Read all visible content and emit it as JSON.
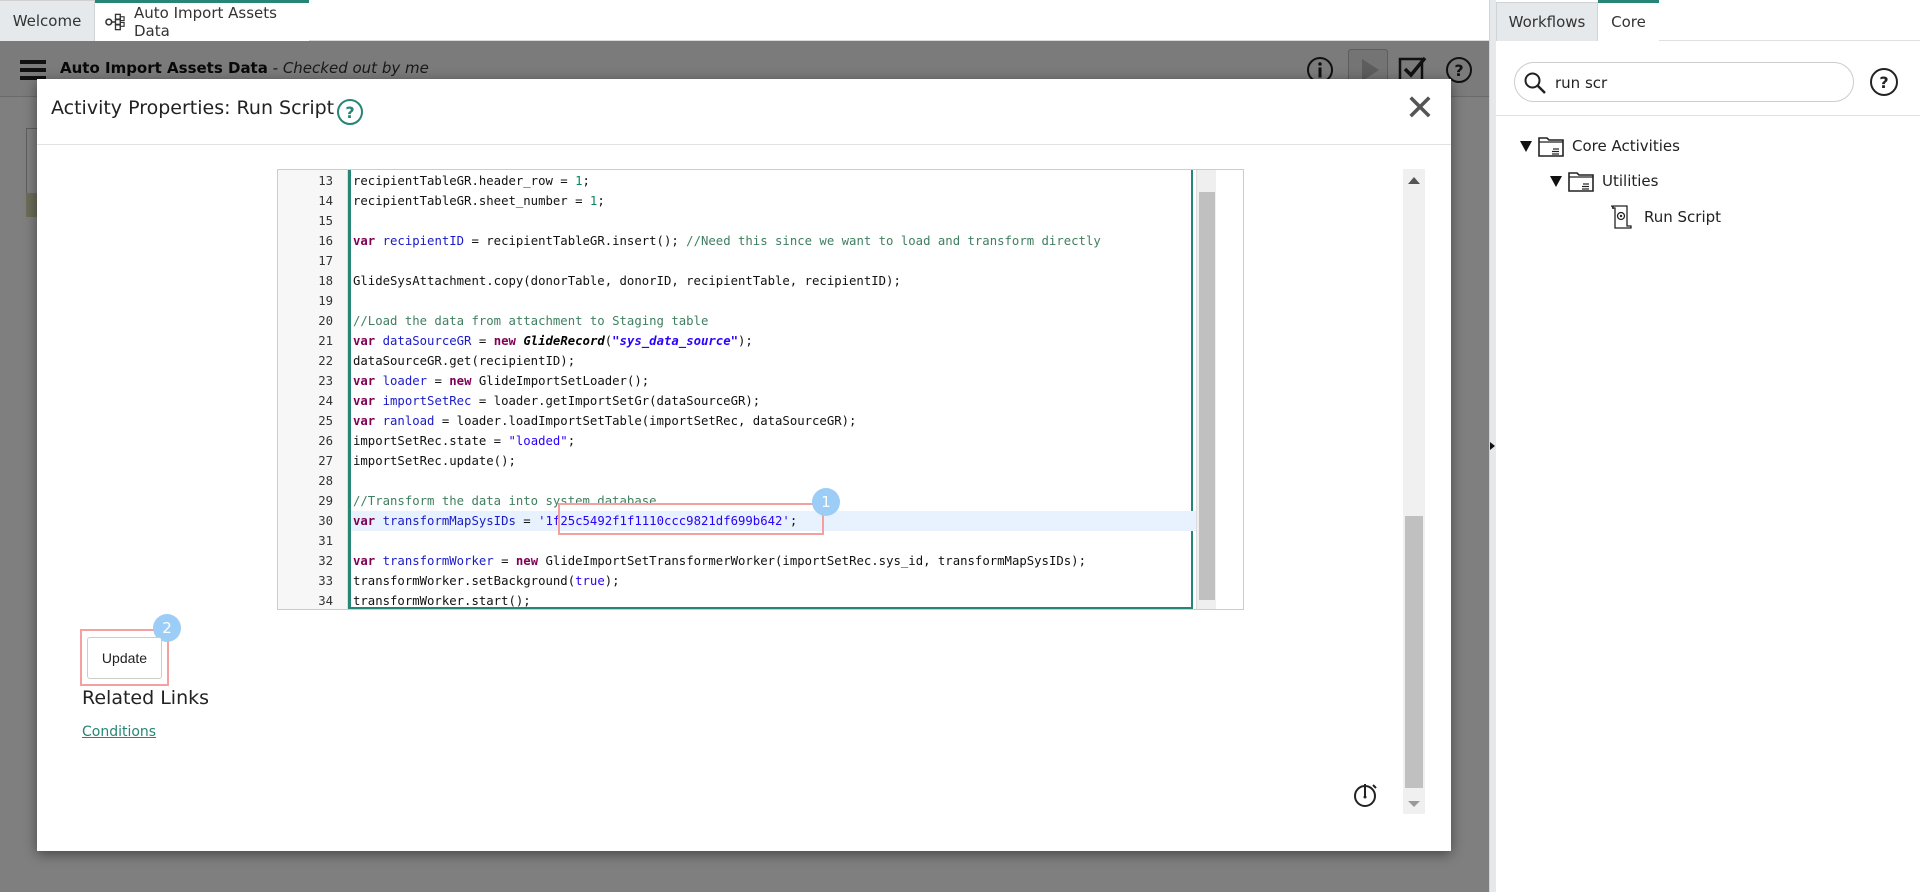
{
  "tabs": {
    "welcome": "Welcome",
    "workflow": "Auto Import Assets Data",
    "workflow_icon": "workflow-icon"
  },
  "header": {
    "workflow_name": "Auto Import Assets Data",
    "status": "- Checked out by me",
    "icons": [
      "menu-icon",
      "info-icon",
      "play-icon",
      "checkbox-icon",
      "help-icon"
    ]
  },
  "modal": {
    "title": "Activity Properties: Run Script",
    "help": "?",
    "close": "✕",
    "update_label": "Update",
    "related_links_label": "Related Links",
    "conditions_link": "Conditions",
    "timer_icon": "stopwatch-icon"
  },
  "editor": {
    "active_line": 30,
    "lines": [
      {
        "n": "13",
        "code": "recipientTableGR.header_row = 1;"
      },
      {
        "n": "14",
        "code": "recipientTableGR.sheet_number = 1;"
      },
      {
        "n": "15",
        "code": ""
      },
      {
        "n": "16",
        "code": "var recipientID = recipientTableGR.insert(); //Need this since we want to load and transform directly"
      },
      {
        "n": "17",
        "code": ""
      },
      {
        "n": "18",
        "code": "GlideSysAttachment.copy(donorTable, donorID, recipientTable, recipientID);"
      },
      {
        "n": "19",
        "code": ""
      },
      {
        "n": "20",
        "code": "//Load the data from attachment to Staging table"
      },
      {
        "n": "21",
        "code": "var dataSourceGR = new GlideRecord(\"sys_data_source\");"
      },
      {
        "n": "22",
        "code": "dataSourceGR.get(recipientID);"
      },
      {
        "n": "23",
        "code": "var loader = new GlideImportSetLoader();"
      },
      {
        "n": "24",
        "code": "var importSetRec = loader.getImportSetGr(dataSourceGR);"
      },
      {
        "n": "25",
        "code": "var ranload = loader.loadImportSetTable(importSetRec, dataSourceGR);"
      },
      {
        "n": "26",
        "code": "importSetRec.state = \"loaded\";"
      },
      {
        "n": "27",
        "code": "importSetRec.update();"
      },
      {
        "n": "28",
        "code": ""
      },
      {
        "n": "29",
        "code": "//Transform the data into system database"
      },
      {
        "n": "30",
        "code": "var transformMapSysIDs = '1f25c5492f1f1110ccc9821df699b642';"
      },
      {
        "n": "31",
        "code": ""
      },
      {
        "n": "32",
        "code": "var transformWorker = new GlideImportSetTransformerWorker(importSetRec.sys_id, transformMapSysIDs);"
      },
      {
        "n": "33",
        "code": "transformWorker.setBackground(true);"
      },
      {
        "n": "34",
        "code": "transformWorker.start();"
      }
    ]
  },
  "annotations": [
    {
      "label": "1",
      "target": "sys-id-string"
    },
    {
      "label": "2",
      "target": "update-button"
    }
  ],
  "right_pane": {
    "tabs": [
      "Workflows",
      "Core"
    ],
    "active_tab": "Core",
    "search_value": "run scr",
    "search_help": "?",
    "tree": [
      {
        "label": "Core Activities",
        "type": "folder",
        "expanded": true
      },
      {
        "label": "Utilities",
        "type": "folder",
        "expanded": true
      },
      {
        "label": "Run Script",
        "type": "activity"
      }
    ]
  },
  "colors": {
    "accent": "#278576",
    "annotation_box": "#f4a0a0",
    "annotation_badge": "#9ccdf7"
  }
}
